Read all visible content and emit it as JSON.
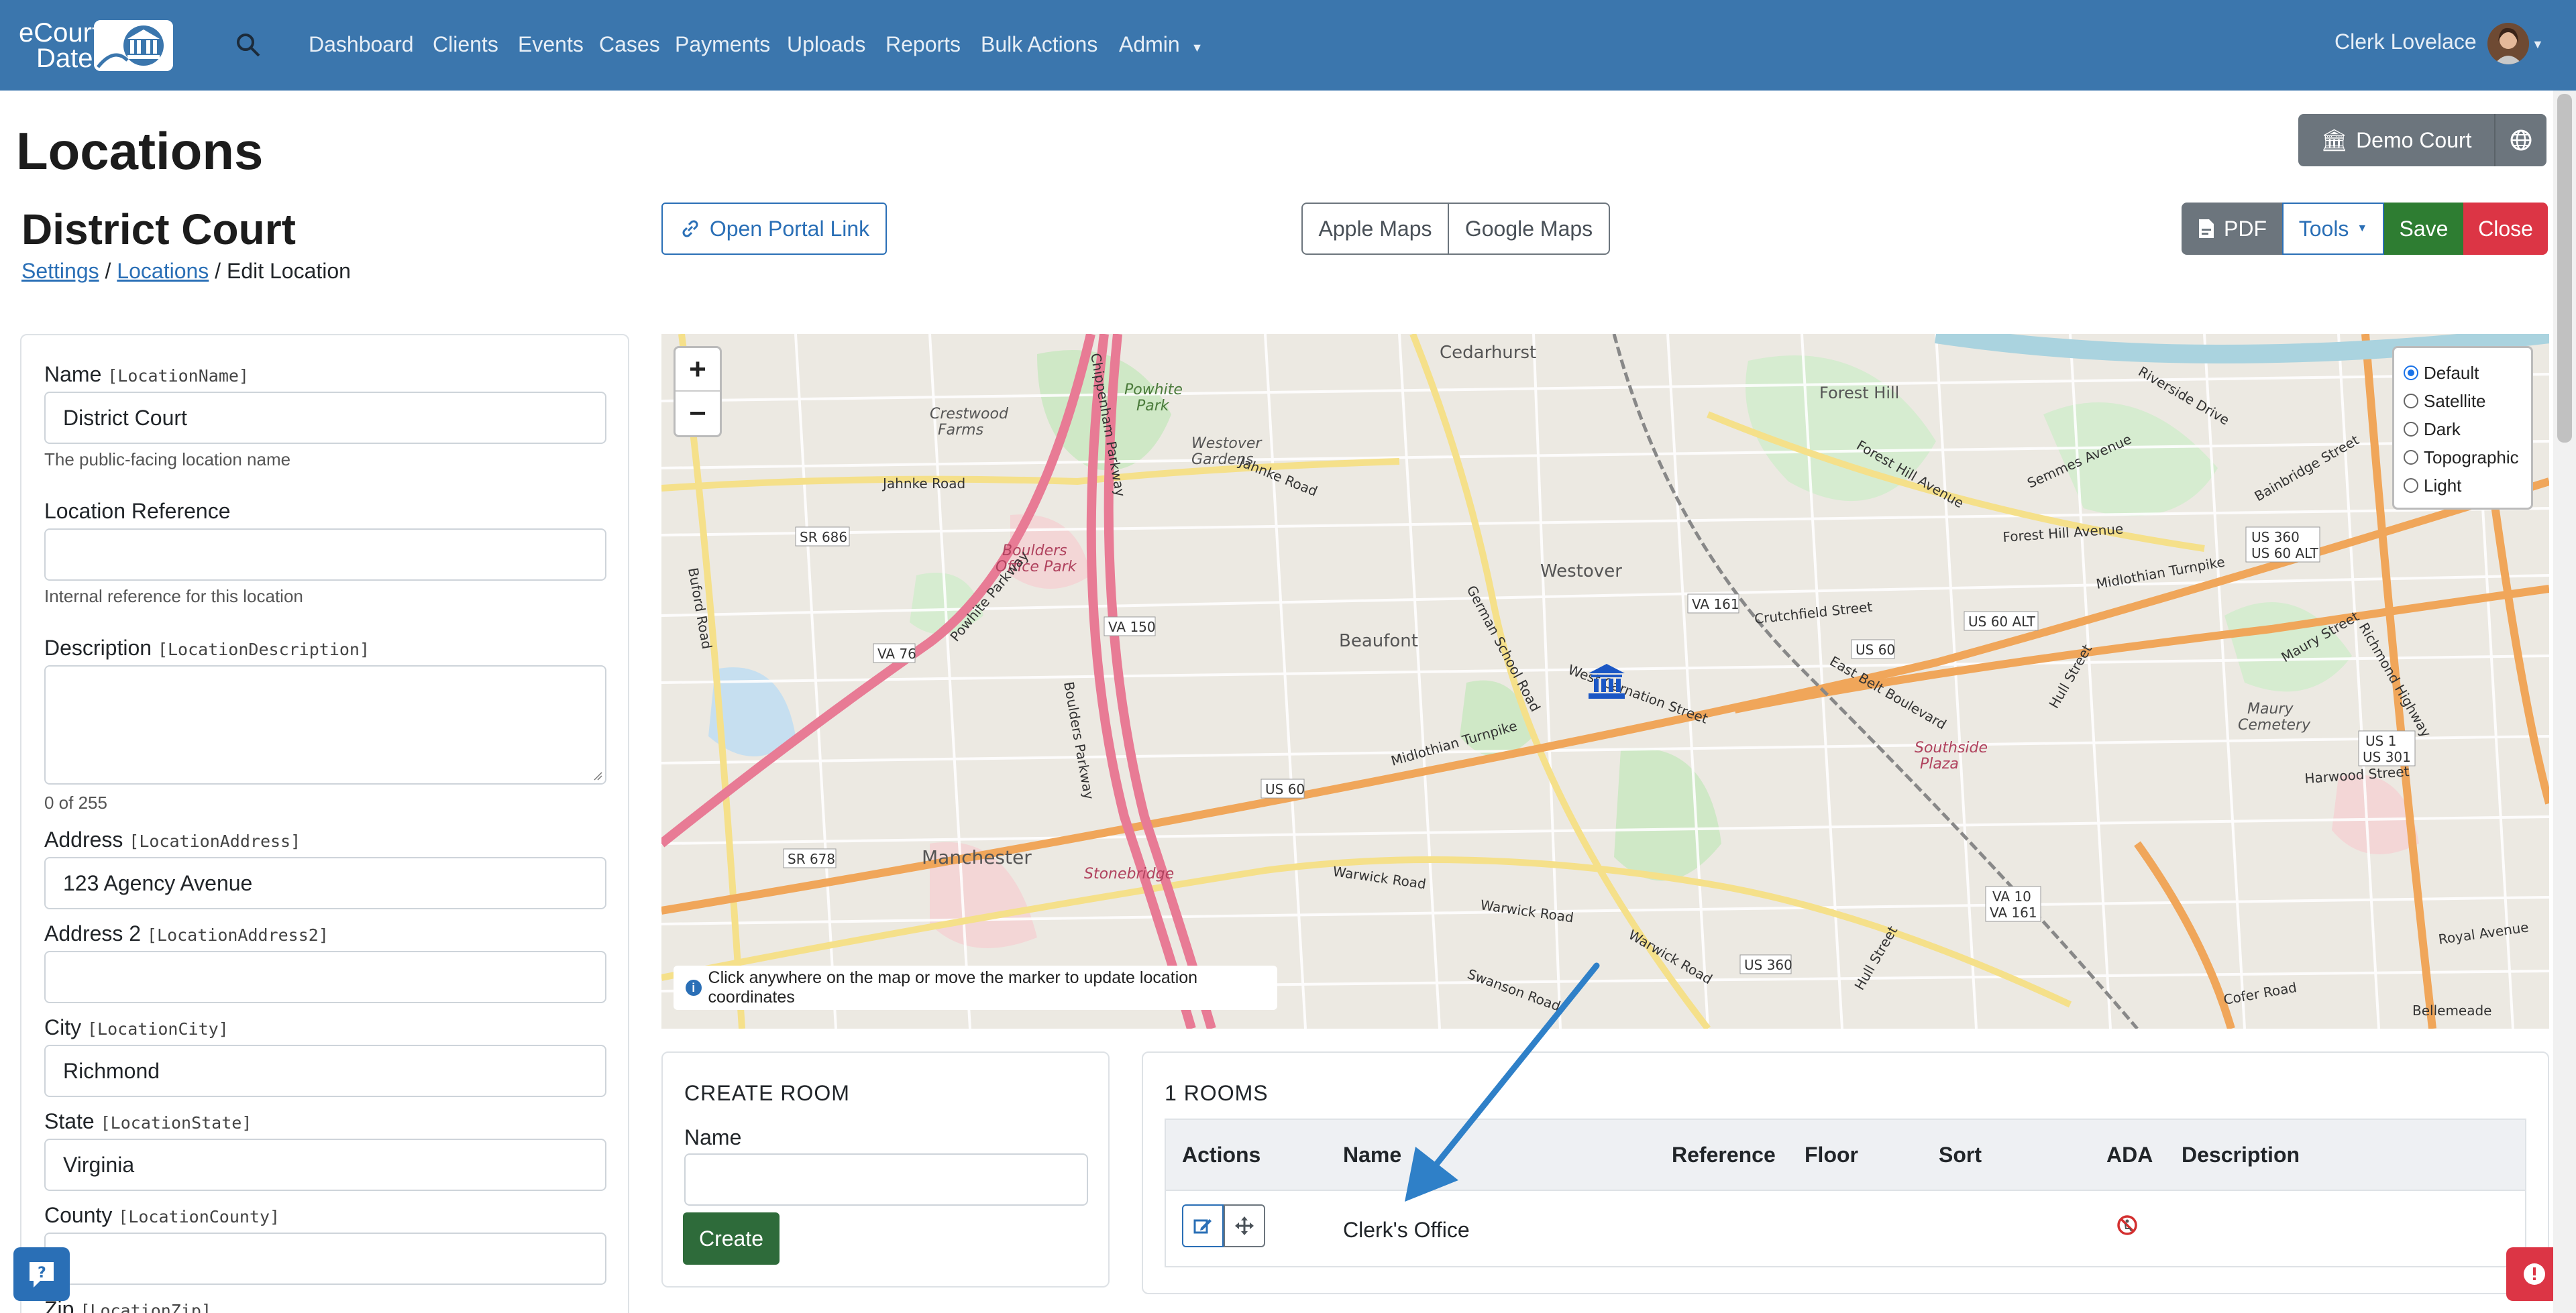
{
  "nav": {
    "brand_line1": "eCourt",
    "brand_line2": "Date",
    "links": [
      "Dashboard",
      "Clients",
      "Events",
      "Cases",
      "Payments",
      "Uploads",
      "Reports",
      "Bulk Actions",
      "Admin"
    ],
    "user": "Clerk Lovelace"
  },
  "header": {
    "title": "Locations",
    "subtitle": "District Court",
    "breadcrumb": [
      "Settings",
      "Locations",
      "Edit Location"
    ],
    "court_button": "Demo Court",
    "portal_button": "Open Portal Link",
    "apple_maps": "Apple Maps",
    "google_maps": "Google Maps",
    "pdf": "PDF",
    "tools": "Tools",
    "save": "Save",
    "close": "Close"
  },
  "form": {
    "name_label": "Name",
    "name_tag": "[LocationName]",
    "name_value": "District Court",
    "name_help": "The public-facing location name",
    "reference_label": "Location Reference",
    "reference_value": "",
    "reference_help": "Internal reference for this location",
    "description_label": "Description",
    "description_tag": "[LocationDescription]",
    "description_count": "0 of 255",
    "address_label": "Address",
    "address_tag": "[LocationAddress]",
    "address_value": "123 Agency Avenue",
    "address2_label": "Address 2",
    "address2_tag": "[LocationAddress2]",
    "address2_value": "",
    "city_label": "City",
    "city_tag": "[LocationCity]",
    "city_value": "Richmond",
    "state_label": "State",
    "state_tag": "[LocationState]",
    "state_value": "Virginia",
    "county_label": "County",
    "county_tag": "[LocationCounty]",
    "county_value": "",
    "zip_label": "Zip",
    "zip_tag": "[LocationZip]"
  },
  "map": {
    "layers": [
      "Default",
      "Satellite",
      "Dark",
      "Topographic",
      "Light"
    ],
    "selected_layer": "Default",
    "hint": "Click anywhere on the map or move the marker to update location coordinates",
    "labels": [
      "Cedarhurst",
      "Forest Hill",
      "Westover Gardens",
      "Crestwood Farms",
      "Boulders Office Park",
      "Westover",
      "Beaufont",
      "Manchester",
      "Stonebridge",
      "Southside Plaza",
      "Maury Cemetery",
      "Powhite Park",
      "SR 686",
      "VA 76",
      "VA 150",
      "VA 161",
      "US 60",
      "US 60 ALT",
      "US 360",
      "US 360 US 60 ALT",
      "US 1 US 301",
      "VA 10 VA 161",
      "SR 678",
      "Jahnke Road",
      "Midlothian Turnpike",
      "Forest Hill Avenue",
      "Warwick Road",
      "Harwood Street",
      "Royal Avenue",
      "Cofer Road",
      "Riverside Drive",
      "Hull Street",
      "German School Road",
      "West Carnation Street",
      "Crutchfield Street",
      "Semmes Avenue",
      "Maury Street",
      "Richmond Highway",
      "Warwick Road",
      "Swanson Road",
      "Bellemeade",
      "Buford Road",
      "Boulders Parkway",
      "Powhite Parkway",
      "Chippenham Parkway",
      "Bainbridge Street",
      "East Belt Boulevard"
    ]
  },
  "create_room": {
    "heading": "CREATE ROOM",
    "name_label": "Name",
    "name_value": "",
    "button": "Create"
  },
  "rooms": {
    "heading": "1 ROOMS",
    "columns": [
      "Actions",
      "Name",
      "Reference",
      "Floor",
      "Sort",
      "ADA",
      "Description"
    ],
    "rows": [
      {
        "name": "Clerk's Office",
        "reference": "",
        "floor": "",
        "sort": "",
        "ada": "no",
        "description": ""
      }
    ]
  },
  "colors": {
    "navbar": "#3b76ad",
    "primary": "#2a6fb6",
    "save": "#2e7d32",
    "close": "#dc3545",
    "secondary": "#6c757d"
  }
}
